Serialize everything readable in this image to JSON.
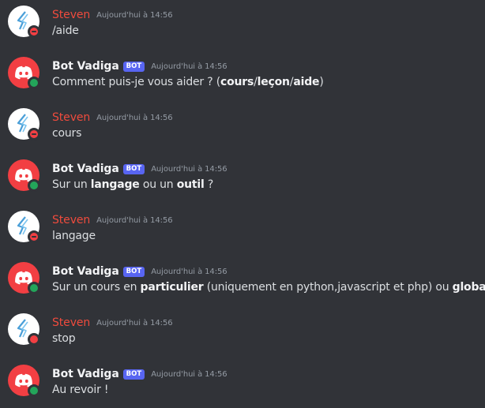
{
  "app": "Discord",
  "colors": {
    "background": "#313338",
    "steven_name": "#ef4b3d",
    "bot_name": "#f2f3f5",
    "bot_tag": "#5865f2",
    "timestamp": "#949ba4",
    "online": "#23a55a",
    "dnd": "#f23f43",
    "bot_avatar": "#f23f43"
  },
  "messages": [
    {
      "author": "Steven",
      "is_bot": false,
      "avatar_icon": "lightning-logo-icon",
      "status": "dnd",
      "timestamp": "Aujourd'hui à 14:56",
      "segments": [
        {
          "text": "/aide",
          "bold": false
        }
      ]
    },
    {
      "author": "Bot Vadiga",
      "is_bot": true,
      "bot_tag": "BOT",
      "avatar_icon": "discord-logo-icon",
      "status": "online",
      "timestamp": "Aujourd'hui à 14:56",
      "segments": [
        {
          "text": "Comment puis-je vous aider ? (",
          "bold": false
        },
        {
          "text": "cours",
          "bold": true
        },
        {
          "text": "/",
          "bold": false
        },
        {
          "text": "leçon",
          "bold": true
        },
        {
          "text": "/",
          "bold": false
        },
        {
          "text": "aide",
          "bold": true
        },
        {
          "text": ")",
          "bold": false
        }
      ]
    },
    {
      "author": "Steven",
      "is_bot": false,
      "avatar_icon": "lightning-logo-icon",
      "status": "dnd",
      "timestamp": "Aujourd'hui à 14:56",
      "segments": [
        {
          "text": "cours",
          "bold": false
        }
      ]
    },
    {
      "author": "Bot Vadiga",
      "is_bot": true,
      "bot_tag": "BOT",
      "avatar_icon": "discord-logo-icon",
      "status": "online",
      "timestamp": "Aujourd'hui à 14:56",
      "segments": [
        {
          "text": "Sur un ",
          "bold": false
        },
        {
          "text": "langage",
          "bold": true
        },
        {
          "text": " ou un ",
          "bold": false
        },
        {
          "text": "outil",
          "bold": true
        },
        {
          "text": " ?",
          "bold": false
        }
      ]
    },
    {
      "author": "Steven",
      "is_bot": false,
      "avatar_icon": "lightning-logo-icon",
      "status": "dnd",
      "timestamp": "Aujourd'hui à 14:56",
      "segments": [
        {
          "text": "langage",
          "bold": false
        }
      ]
    },
    {
      "author": "Bot Vadiga",
      "is_bot": true,
      "bot_tag": "BOT",
      "avatar_icon": "discord-logo-icon",
      "status": "online",
      "timestamp": "Aujourd'hui à 14:56",
      "segments": [
        {
          "text": "Sur un cours en ",
          "bold": false
        },
        {
          "text": "particulier",
          "bold": true
        },
        {
          "text": " (uniquement en python,javascript et php) ou ",
          "bold": false
        },
        {
          "text": "global",
          "bold": true
        },
        {
          "text": " ?",
          "bold": false
        }
      ]
    },
    {
      "author": "Steven",
      "is_bot": false,
      "avatar_icon": "lightning-logo-icon",
      "status": "offline-red",
      "timestamp": "Aujourd'hui à 14:56",
      "segments": [
        {
          "text": "stop",
          "bold": false
        }
      ]
    },
    {
      "author": "Bot Vadiga",
      "is_bot": true,
      "bot_tag": "BOT",
      "avatar_icon": "discord-logo-icon",
      "status": "online",
      "timestamp": "Aujourd'hui à 14:56",
      "segments": [
        {
          "text": "Au revoir !",
          "bold": false
        }
      ]
    }
  ]
}
